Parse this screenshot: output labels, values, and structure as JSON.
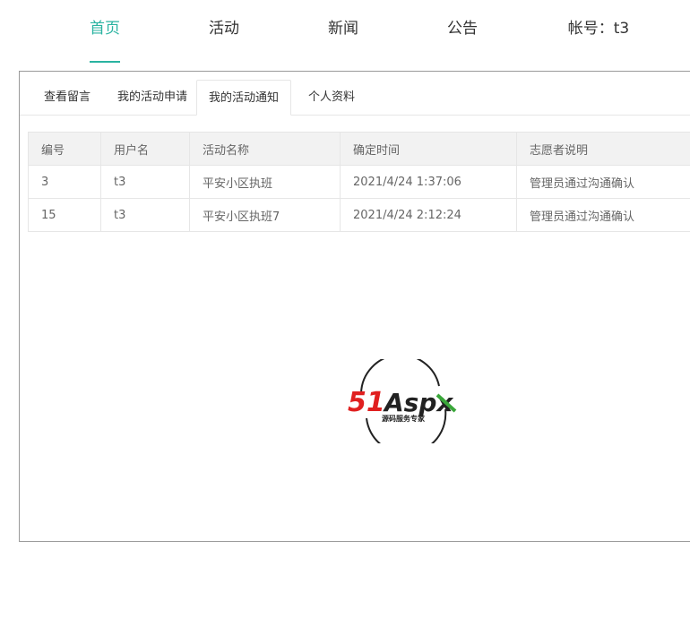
{
  "nav": {
    "items": [
      {
        "label": "首页",
        "active": true
      },
      {
        "label": "活动",
        "active": false
      },
      {
        "label": "新闻",
        "active": false
      },
      {
        "label": "公告",
        "active": false
      }
    ],
    "account_label": "帐号：t3",
    "active_color": "#2ab3a1"
  },
  "tabs": [
    {
      "label": "查看留言",
      "active": false
    },
    {
      "label": "我的活动申请",
      "active": false
    },
    {
      "label": "我的活动通知",
      "active": true
    },
    {
      "label": "个人资料",
      "active": false
    }
  ],
  "table": {
    "headers": [
      "编号",
      "用户名",
      "活动名称",
      "确定时间",
      "志愿者说明"
    ],
    "rows": [
      [
        "3",
        "t3",
        "平安小区执班",
        "2021/4/24 1:37:06",
        "管理员通过沟通确认"
      ],
      [
        "15",
        "t3",
        "平安小区执班7",
        "2021/4/24 2:12:24",
        "管理员通过沟通确认"
      ]
    ]
  },
  "logo": {
    "text_51": "51",
    "text_aspx": "Aspx",
    "tagline": "源码服务专家",
    "colors": {
      "red": "#e02020",
      "green": "#3aa73a",
      "dark": "#222222"
    }
  }
}
